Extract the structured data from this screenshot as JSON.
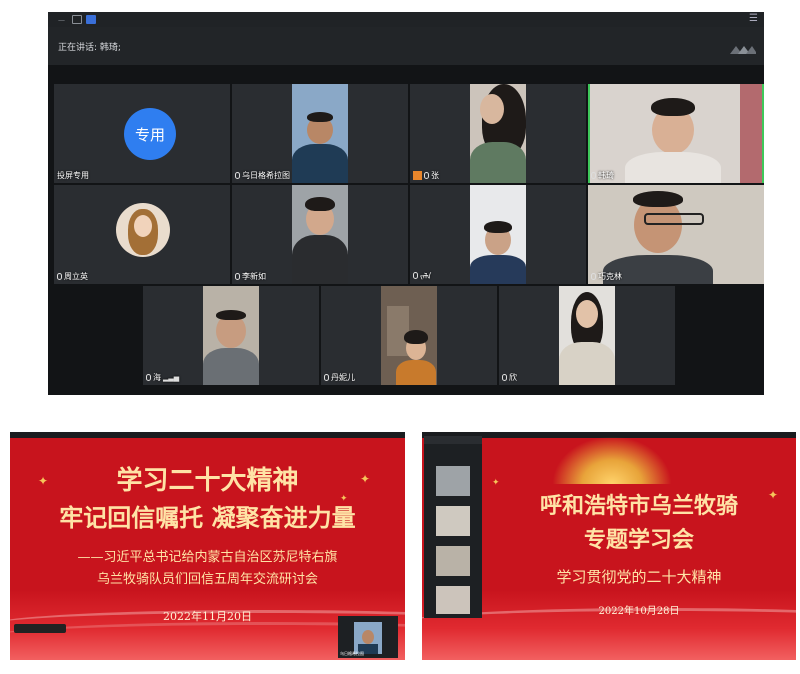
{
  "meeting": {
    "speaking_label": "正在讲话: 韩琦;",
    "participants": [
      {
        "name": "投屏专用",
        "avatar_text": "专用",
        "type": "avatar"
      },
      {
        "name": "乌日格希拉图",
        "type": "video"
      },
      {
        "name": "张",
        "type": "video"
      },
      {
        "name": "韩琦",
        "type": "video",
        "active": true
      },
      {
        "name": "周立英",
        "type": "avatar"
      },
      {
        "name": "李新如",
        "type": "video"
      },
      {
        "name": "ᠵᠠᠯᠠ",
        "type": "video"
      },
      {
        "name": "巧克林",
        "type": "video"
      },
      {
        "name": "海",
        "type": "video"
      },
      {
        "name": "丹妮儿",
        "type": "video"
      },
      {
        "name": "欣",
        "type": "video"
      }
    ]
  },
  "slide_left": {
    "title_line1": "学习二十大精神",
    "title_line2": "牢记回信嘱托 凝聚奋进力量",
    "sub_line1": "——习近平总书记给内蒙古自治区苏尼特右旗",
    "sub_line2": "乌兰牧骑队员们回信五周年交流研讨会",
    "date": "2022年11月20日",
    "pip_name": "乌日格希拉图"
  },
  "slide_right": {
    "title_line1": "呼和浩特市乌兰牧骑",
    "title_line2": "专题学习会",
    "subtitle": "学习贯彻党的二十大精神",
    "date": "2022年10月28日"
  },
  "colors": {
    "slide_red": "#c8141d",
    "title_gold": "#ffe3a6",
    "active_border": "#3ec85a",
    "avatar_blue": "#2f7ef0"
  }
}
